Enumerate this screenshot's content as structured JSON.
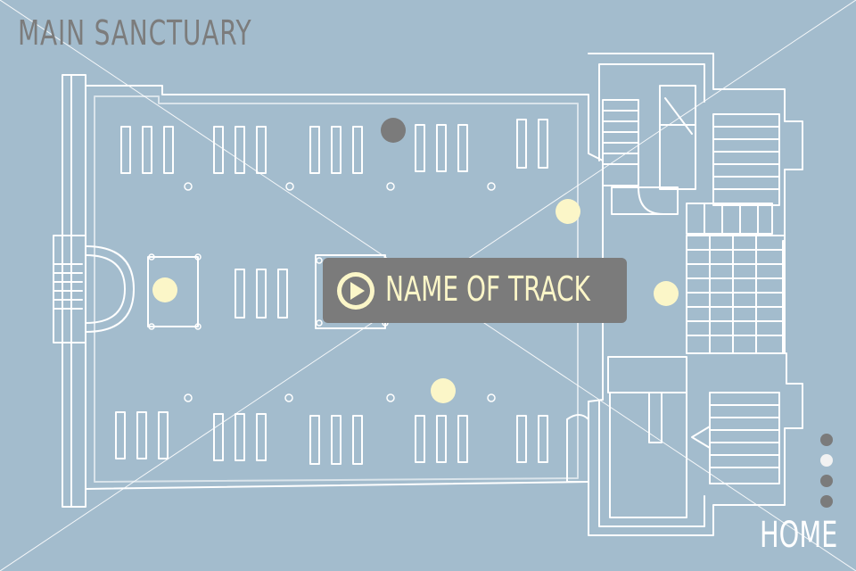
{
  "header": {
    "title": "MAIN SANCTUARY"
  },
  "player": {
    "track_name": "NAME OF TRACK",
    "play_icon": "play-icon"
  },
  "nav": {
    "home_label": "HOME"
  },
  "pager": {
    "total": 4,
    "active": 1,
    "active_color": "#f2f2f2",
    "inactive_color": "#7b7b7b"
  },
  "map": {
    "hotspots": [
      {
        "id": "hotspot-apse",
        "color": "#fbf6c8"
      },
      {
        "id": "hotspot-nave-north",
        "color": "#7b7b7b"
      },
      {
        "id": "hotspot-nave-east",
        "color": "#fbf6c8"
      },
      {
        "id": "hotspot-nave-south",
        "color": "#fbf6c8"
      },
      {
        "id": "hotspot-narthex",
        "color": "#fbf6c8"
      }
    ],
    "colors": {
      "background": "#a3bccd",
      "lines": "#ffffff"
    }
  }
}
